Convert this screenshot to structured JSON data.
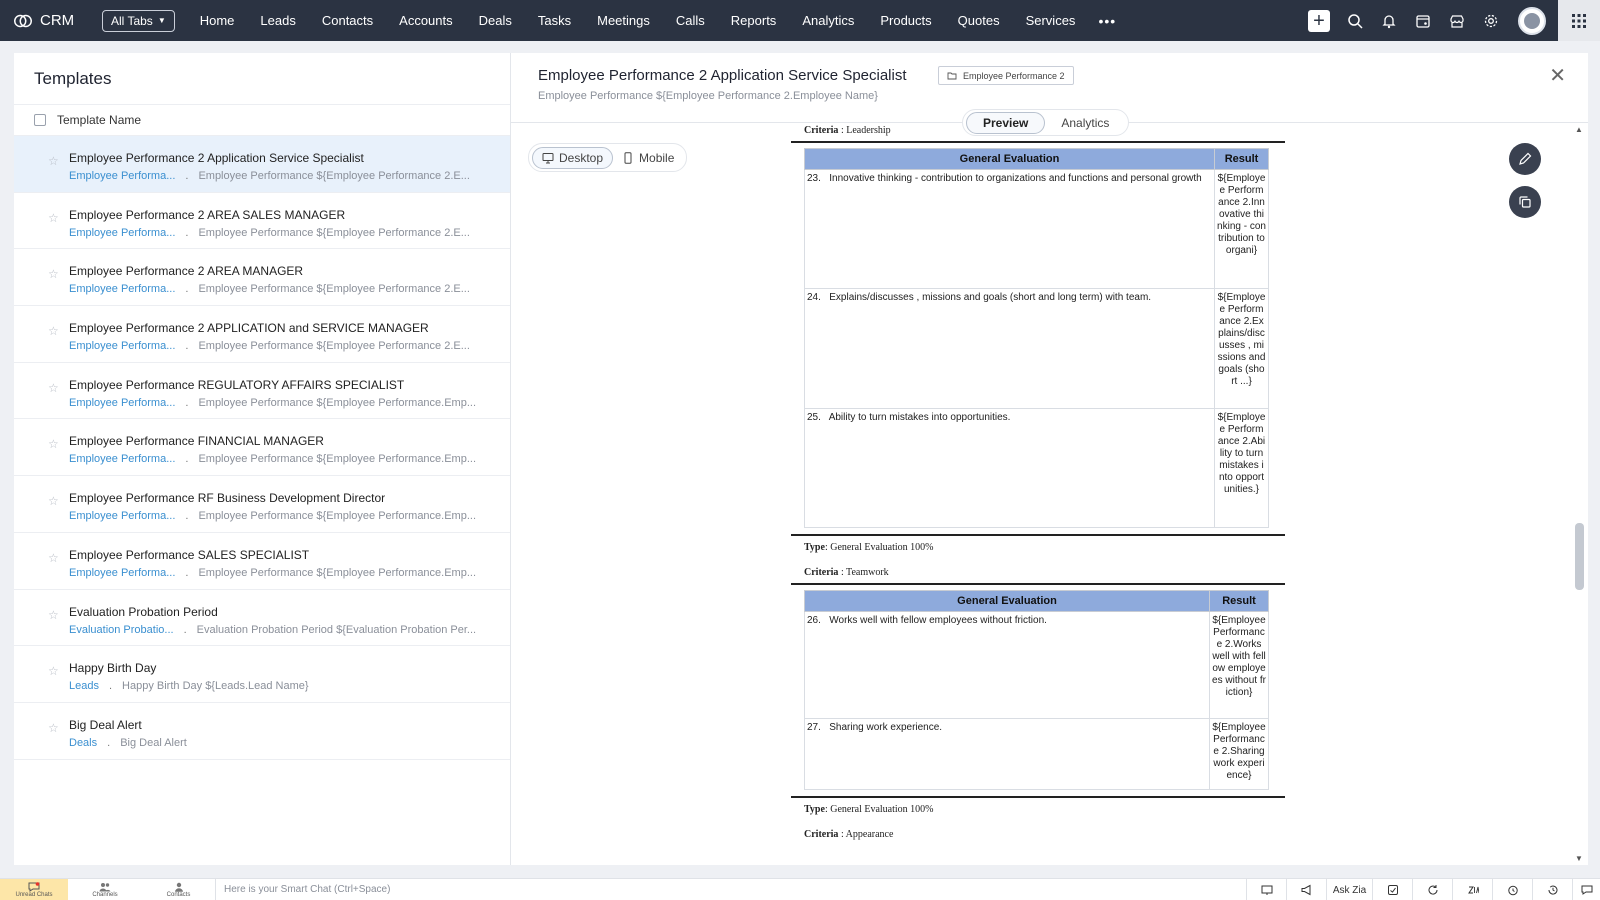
{
  "nav": {
    "brand": "CRM",
    "all_tabs": "All Tabs",
    "tabs": [
      "Home",
      "Leads",
      "Contacts",
      "Accounts",
      "Deals",
      "Tasks",
      "Meetings",
      "Calls",
      "Reports",
      "Analytics",
      "Products",
      "Quotes",
      "Services"
    ],
    "more": "•••"
  },
  "left": {
    "title": "Templates",
    "column_header": "Template Name",
    "templates": [
      {
        "name": "Employee Performance 2 Application Service Specialist",
        "module": "Employee Performa...",
        "subject": "Employee Performance ${Employee Performance 2.E..."
      },
      {
        "name": "Employee Performance 2 AREA SALES MANAGER",
        "module": "Employee Performa...",
        "subject": "Employee Performance ${Employee Performance 2.E..."
      },
      {
        "name": "Employee Performance 2 AREA MANAGER",
        "module": "Employee Performa...",
        "subject": "Employee Performance ${Employee Performance 2.E..."
      },
      {
        "name": "Employee Performance 2 APPLICATION and SERVICE MANAGER",
        "module": "Employee Performa...",
        "subject": "Employee Performance ${Employee Performance 2.E..."
      },
      {
        "name": "Employee Performance REGULATORY AFFAIRS SPECIALIST",
        "module": "Employee Performa...",
        "subject": "Employee Performance ${Employee Performance.Emp..."
      },
      {
        "name": "Employee Performance FINANCIAL MANAGER",
        "module": "Employee Performa...",
        "subject": "Employee Performance ${Employee Performance.Emp..."
      },
      {
        "name": "Employee Performance RF Business Development Director",
        "module": "Employee Performa...",
        "subject": "Employee Performance ${Employee Performance.Emp..."
      },
      {
        "name": "Employee Performance SALES SPECIALIST",
        "module": "Employee Performa...",
        "subject": "Employee Performance ${Employee Performance.Emp..."
      },
      {
        "name": "Evaluation Probation Period",
        "module": "Evaluation Probatio...",
        "subject": "Evaluation Probation Period ${Evaluation Probation Per..."
      },
      {
        "name": "Happy Birth Day",
        "module": "Leads",
        "subject": "Happy Birth Day ${Leads.Lead Name}"
      },
      {
        "name": "Big Deal Alert",
        "module": "Deals",
        "subject": "Big Deal Alert"
      }
    ]
  },
  "detail": {
    "title": "Employee Performance 2 Application Service Specialist",
    "module_badge": "Employee Performance 2",
    "subject": "Employee Performance ${Employee Performance 2.Employee Name}",
    "tabs": {
      "preview": "Preview",
      "analytics": "Analytics"
    },
    "devices": {
      "desktop": "Desktop",
      "mobile": "Mobile"
    },
    "close": "✕"
  },
  "doc": {
    "criteria_label": "Criteria",
    "type_label": "Type",
    "type_value": ": General  Evaluation 100%",
    "criteria1": ": Leadership",
    "criteria2": ": Teamwork",
    "criteria3": ": Appearance",
    "header_eval": "General Evaluation",
    "header_result": "Result",
    "table1": [
      {
        "num": "23.",
        "text": "Innovative thinking - contribution to organizations and functions and personal growth",
        "result": "${Employee Performance 2.Innovative thinking - contribution to organi}"
      },
      {
        "num": "24.",
        "text": "Explains/discusses , missions and goals (short and long term) with team.",
        "result": "${Employee Performance 2.Explains/discusses , missions and goals (short ...}"
      },
      {
        "num": "25.",
        "text": "Ability to turn mistakes into opportunities.",
        "result": "${Employee Performance 2.Ability to turn mistakes into opportunities.}"
      }
    ],
    "table2": [
      {
        "num": "26.",
        "text": "Works well with fellow employees without friction.",
        "result": "${Employee Performance 2.Works well with fellow employees without friction}"
      },
      {
        "num": "27.",
        "text": "Sharing work experience.",
        "result": "${Employee Performance 2.Sharing work experience}"
      }
    ]
  },
  "bottom": {
    "unread": "Unread Chats",
    "channels": "Channels",
    "contacts": "Contacts",
    "smart_chat": "Here is your Smart Chat (Ctrl+Space)",
    "ask_zia": "Ask Zia"
  }
}
